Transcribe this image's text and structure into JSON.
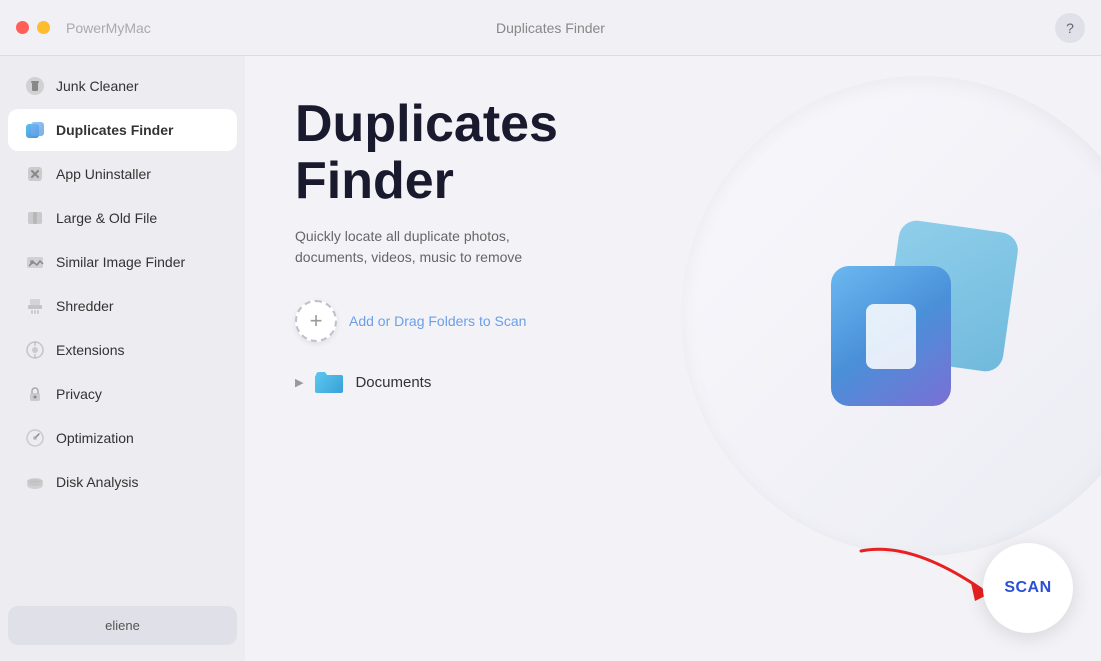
{
  "titlebar": {
    "app_name": "PowerMyMac",
    "window_title": "Duplicates Finder",
    "help_label": "?"
  },
  "sidebar": {
    "items": [
      {
        "id": "junk-cleaner",
        "label": "Junk Cleaner",
        "active": false
      },
      {
        "id": "duplicates-finder",
        "label": "Duplicates Finder",
        "active": true
      },
      {
        "id": "app-uninstaller",
        "label": "App Uninstaller",
        "active": false
      },
      {
        "id": "large-old-file",
        "label": "Large & Old File",
        "active": false
      },
      {
        "id": "similar-image-finder",
        "label": "Similar Image Finder",
        "active": false
      },
      {
        "id": "shredder",
        "label": "Shredder",
        "active": false
      },
      {
        "id": "extensions",
        "label": "Extensions",
        "active": false
      },
      {
        "id": "privacy",
        "label": "Privacy",
        "active": false
      },
      {
        "id": "optimization",
        "label": "Optimization",
        "active": false
      },
      {
        "id": "disk-analysis",
        "label": "Disk Analysis",
        "active": false
      }
    ],
    "user_label": "eliene"
  },
  "main": {
    "heading_line1": "Duplicates",
    "heading_line2": "Finder",
    "description": "Quickly locate all duplicate photos, documents, videos, music to remove",
    "add_folder_label": "Add or Drag Folders to Scan",
    "folder_item": {
      "name": "Documents"
    },
    "scan_button_label": "SCAN"
  }
}
